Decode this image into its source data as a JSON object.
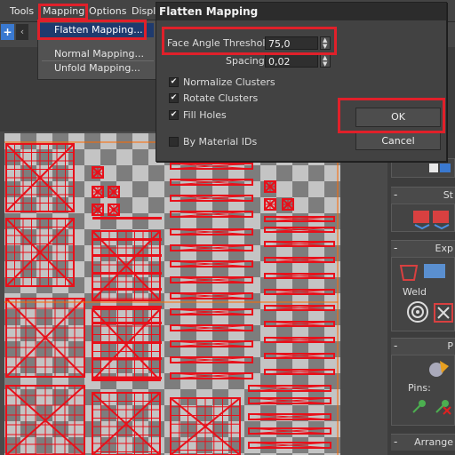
{
  "menubar": {
    "items": [
      "Tools",
      "Mapping",
      "Options",
      "Displ"
    ]
  },
  "toolbar": {
    "plus_label": "+",
    "nav_label": "‹"
  },
  "mapping_menu": {
    "items": [
      "Flatten Mapping...",
      "Normal Mapping...",
      "Unfold Mapping..."
    ],
    "selected": "Flatten Mapping..."
  },
  "dialog": {
    "title": "Flatten Mapping",
    "face_angle_label": "Face Angle Threshold:",
    "face_angle_value": "75,0",
    "spacing_label": "Spacing:",
    "spacing_value": "0,02",
    "normalize_clusters": {
      "label": "Normalize Clusters",
      "checked": true
    },
    "rotate_clusters": {
      "label": "Rotate Clusters",
      "checked": true
    },
    "fill_holes": {
      "label": "Fill Holes",
      "checked": true
    },
    "by_material_ids": {
      "label": "By Material IDs",
      "checked": false
    },
    "ok_label": "OK",
    "cancel_label": "Cancel"
  },
  "command_panel": {
    "rollout_st": "St",
    "rollout_exp": "Exp",
    "weld_label": "Weld",
    "rollout_p": "P",
    "pins_label": "Pins:",
    "rollout_arrange": "Arrange",
    "minus": "-"
  },
  "colors": {
    "highlight": "#e0202a",
    "selection": "#1e3a6e",
    "uv_edge": "#e8101a"
  },
  "icons": [
    "plus-icon",
    "chevron-left-icon",
    "weld-target-icon",
    "pin-add-icon",
    "pin-remove-icon"
  ]
}
